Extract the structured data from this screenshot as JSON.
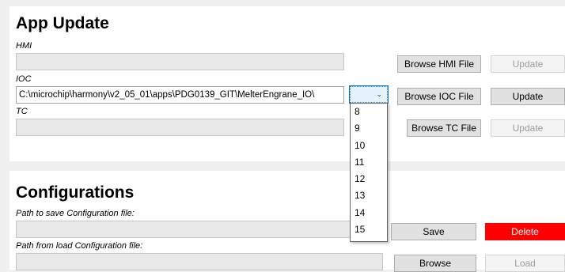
{
  "app_update": {
    "title": "App Update",
    "hmi": {
      "label": "HMI",
      "value": "",
      "browse": "Browse HMI File",
      "update": "Update"
    },
    "ioc": {
      "label": "IOC",
      "value": "C:\\microchip\\harmony\\v2_05_01\\apps\\PDG0139_GIT\\MelterEngrane_IO\\",
      "browse": "Browse IOC File",
      "update": "Update"
    },
    "tc": {
      "label": "TC",
      "value": "",
      "browse": "Browse TC File",
      "update": "Update"
    },
    "ioc_dropdown": {
      "selected": "",
      "options": [
        "8",
        "9",
        "10",
        "11",
        "12",
        "13",
        "14",
        "15"
      ]
    }
  },
  "configurations": {
    "title": "Configurations",
    "save_path": {
      "label": "Path to save Configuration file:",
      "value": "",
      "save": "Save",
      "delete": "Delete"
    },
    "load_path": {
      "label": "Path from load Configuration file:",
      "value": "",
      "browse": "Browse",
      "load": "Load"
    }
  },
  "colors": {
    "delete_button": "#ff0000",
    "focus": "#0078d7"
  }
}
